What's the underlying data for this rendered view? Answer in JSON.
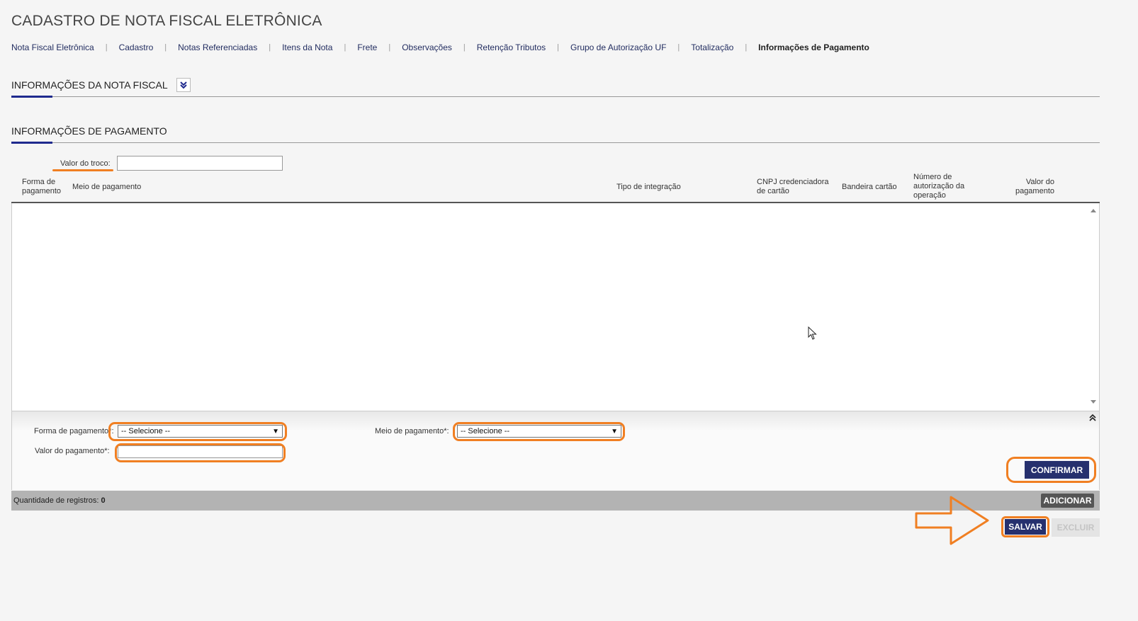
{
  "page": {
    "title": "CADASTRO DE NOTA FISCAL ELETRÔNICA"
  },
  "tabs": [
    {
      "label": "Nota Fiscal Eletrônica"
    },
    {
      "label": "Cadastro"
    },
    {
      "label": "Notas Referenciadas"
    },
    {
      "label": "Itens da Nota"
    },
    {
      "label": "Frete"
    },
    {
      "label": "Observações"
    },
    {
      "label": "Retenção Tributos"
    },
    {
      "label": "Grupo de Autorização UF"
    },
    {
      "label": "Totalização"
    },
    {
      "label": "Informações de Pagamento",
      "active": true
    }
  ],
  "sections": {
    "nota_fiscal": "INFORMAÇÕES DA NOTA FISCAL",
    "pagamento": "INFORMAÇÕES DE PAGAMENTO"
  },
  "troco": {
    "label": "Valor do troco:",
    "value": ""
  },
  "grid": {
    "columns": [
      "Forma de pagamento",
      "Meio de pagamento",
      "Tipo de integração",
      "CNPJ credenciadora de cartão",
      "Bandeira cartão",
      "Número de autorização da operação",
      "Valor do pagamento"
    ],
    "rows": []
  },
  "form": {
    "forma_label": "Forma de pagamento*:",
    "forma_value": "-- Selecione --",
    "meio_label": "Meio de pagamento*:",
    "meio_value": "-- Selecione --",
    "valor_label": "Valor do pagamento*:",
    "valor_value": ""
  },
  "buttons": {
    "confirmar": "CONFIRMAR",
    "adicionar": "ADICIONAR",
    "salvar": "SALVAR",
    "excluir": "EXCLUIR"
  },
  "footer": {
    "count_label": "Quantidade de registros:",
    "count": "0"
  },
  "colors": {
    "accent": "#26306e",
    "highlight": "#f07f22"
  },
  "icons": [
    "expand-down-icon",
    "collapse-up-icon",
    "mouse-cursor-icon",
    "arrow-right-icon",
    "chevron-down-icon"
  ]
}
